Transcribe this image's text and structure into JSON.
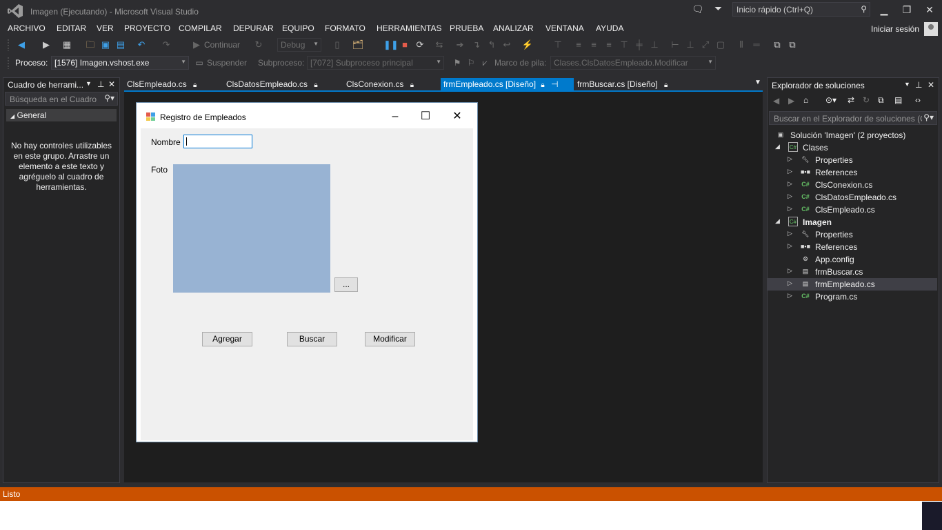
{
  "window": {
    "title": "Imagen (Ejecutando) - Microsoft Visual Studio",
    "quick_launch_placeholder": "Inicio rápido (Ctrl+Q)"
  },
  "menu": [
    "ARCHIVO",
    "EDITAR",
    "VER",
    "PROYECTO",
    "COMPILAR",
    "DEPURAR",
    "EQUIPO",
    "FORMATO",
    "HERRAMIENTAS",
    "PRUEBA",
    "ANALIZAR",
    "VENTANA",
    "AYUDA"
  ],
  "account": {
    "signin_label": "Iniciar sesión"
  },
  "toolbar": {
    "continue_label": "Continuar",
    "config_value": "Debug"
  },
  "debug_bar": {
    "process_label": "Proceso:",
    "process_value": "[1576] Imagen.vshost.exe",
    "suspend_label": "Suspender",
    "thread_label": "Subproceso:",
    "thread_value": "[7072] Subproceso principal",
    "stack_label": "Marco de pila:",
    "stack_value": "Clases.ClsDatosEmpleado.Modificar"
  },
  "toolbox": {
    "title": "Cuadro de herrami...",
    "search_placeholder": "Búsqueda en el Cuadro",
    "group": "General",
    "message": "No hay controles utilizables en este grupo. Arrastre un elemento a este texto y agréguelo al cuadro de herramientas."
  },
  "tabs": [
    {
      "label": "ClsEmpleado.cs"
    },
    {
      "label": "ClsDatosEmpleado.cs"
    },
    {
      "label": "ClsConexion.cs"
    },
    {
      "label": "frmEmpleado.cs [Diseño]"
    },
    {
      "label": "frmBuscar.cs [Diseño]"
    }
  ],
  "form": {
    "title": "Registro de Empleados",
    "nombre_label": "Nombre",
    "nombre_value": "",
    "foto_label": "Foto",
    "browse_label": "...",
    "agregar_label": "Agregar",
    "buscar_label": "Buscar",
    "modificar_label": "Modificar",
    "picture_color": "#98b3d3"
  },
  "solution_explorer": {
    "title": "Explorador de soluciones",
    "search_placeholder": "Buscar en el Explorador de soluciones (C",
    "solution_label": "Solución 'Imagen'  (2 proyectos)",
    "items": [
      {
        "label": "Clases",
        "kind": "project",
        "bold": false
      },
      {
        "label": "Properties",
        "kind": "wrench"
      },
      {
        "label": "References",
        "kind": "refs"
      },
      {
        "label": "ClsConexion.cs",
        "kind": "cs"
      },
      {
        "label": "ClsDatosEmpleado.cs",
        "kind": "cs"
      },
      {
        "label": "ClsEmpleado.cs",
        "kind": "cs"
      },
      {
        "label": "Imagen",
        "kind": "project",
        "bold": true
      },
      {
        "label": "Properties",
        "kind": "wrench"
      },
      {
        "label": "References",
        "kind": "refs"
      },
      {
        "label": "App.config",
        "kind": "config"
      },
      {
        "label": "frmBuscar.cs",
        "kind": "form"
      },
      {
        "label": "frmEmpleado.cs",
        "kind": "form",
        "selected": true
      },
      {
        "label": "Program.cs",
        "kind": "cs"
      }
    ]
  },
  "status": {
    "text": "Listo",
    "color": "#ca5100"
  },
  "colors": {
    "accent": "#007acc",
    "background": "#2d2d30",
    "editor": "#1e1e1e"
  }
}
